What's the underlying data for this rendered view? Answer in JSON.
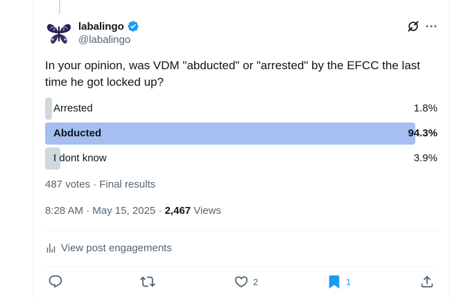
{
  "author": {
    "name": "labalingo",
    "handle": "@labalingo",
    "verified": true
  },
  "post": {
    "text": "In your opinion, was VDM \"abducted\" or \"arrested\" by the EFCC the last time he got locked up?"
  },
  "poll": {
    "options": [
      {
        "label": "Arrested",
        "percent_text": "1.8%",
        "percent": 1.8,
        "winner": false
      },
      {
        "label": "Abducted",
        "percent_text": "94.3%",
        "percent": 94.3,
        "winner": true
      },
      {
        "label": "I dont know",
        "percent_text": "3.9%",
        "percent": 3.9,
        "winner": false
      }
    ],
    "meta": "487 votes · Final results"
  },
  "timestamp": {
    "time_date": "8:28 AM · May 15, 2025 · ",
    "views_count": "2,467",
    "views_label": " Views"
  },
  "engagements_label": "View post engagements",
  "actions": {
    "reply_count": "",
    "repost_count": "",
    "like_count": "2",
    "bookmark_count": "1"
  },
  "colors": {
    "winner_bar": "#a4bff0",
    "loser_bar": "#cfd9de",
    "accent": "#1d9bf0",
    "muted_text": "#536471"
  },
  "icons": [
    "verified-badge-icon",
    "grok-icon",
    "more-icon",
    "analytics-icon",
    "reply-icon",
    "repost-icon",
    "like-icon",
    "bookmark-icon",
    "share-icon"
  ]
}
